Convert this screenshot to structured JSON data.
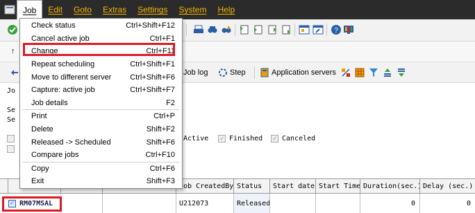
{
  "menubar": {
    "items": [
      "Job",
      "Edit",
      "Goto",
      "Extras",
      "Settings",
      "System",
      "Help"
    ],
    "active": "Job"
  },
  "job_menu": {
    "items": [
      {
        "label": "Check status",
        "shortcut": "Ctrl+Shift+F12"
      },
      {
        "label": "Cancel active job",
        "shortcut": "Ctrl+F1"
      },
      {
        "label": "Change",
        "shortcut": "Ctrl+F11",
        "highlighted": true
      },
      {
        "label": "Repeat scheduling",
        "shortcut": "Ctrl+Shift+F1"
      },
      {
        "label": "Move to different server",
        "shortcut": "Ctrl+Shift+F6"
      },
      {
        "label": "Capture: active job",
        "shortcut": "Ctrl+Shift+F7"
      },
      {
        "label": "Job details",
        "shortcut": "F2"
      },
      {
        "label": "Print",
        "shortcut": "Ctrl+P"
      },
      {
        "label": "Delete",
        "shortcut": "Shift+F2"
      },
      {
        "label": "Released -> Scheduled",
        "shortcut": "Shift+F6"
      },
      {
        "label": "Compare jobs",
        "shortcut": "Ctrl+F10"
      },
      {
        "label": "Copy",
        "shortcut": "Ctrl+F6"
      },
      {
        "label": "Exit",
        "shortcut": "Shift+F3"
      }
    ]
  },
  "toolbar2": {
    "job_log_label": "Job log",
    "step_label": "Step",
    "app_servers_label": "Application servers"
  },
  "partial_text": {
    "jo": "Jo",
    "se1": "Se",
    "se2": "Se"
  },
  "status_filters": {
    "active": "Active",
    "finished": "Finished",
    "canceled": "Canceled"
  },
  "grid": {
    "columns": [
      "Job CreatedBy",
      "Status",
      "Start date",
      "Start Time",
      "Duration(sec.)",
      "Delay (sec.)"
    ],
    "rows": [
      {
        "job_name": "RM07MSAL",
        "created_by": "U212073",
        "status": "Released",
        "start_date": "",
        "start_time": "",
        "duration": "0",
        "delay": "0",
        "selected": true
      }
    ]
  },
  "colors": {
    "menubar_bg": "#2b2b2b",
    "menu_text": "#f5b400",
    "highlight_red": "#e01822"
  }
}
